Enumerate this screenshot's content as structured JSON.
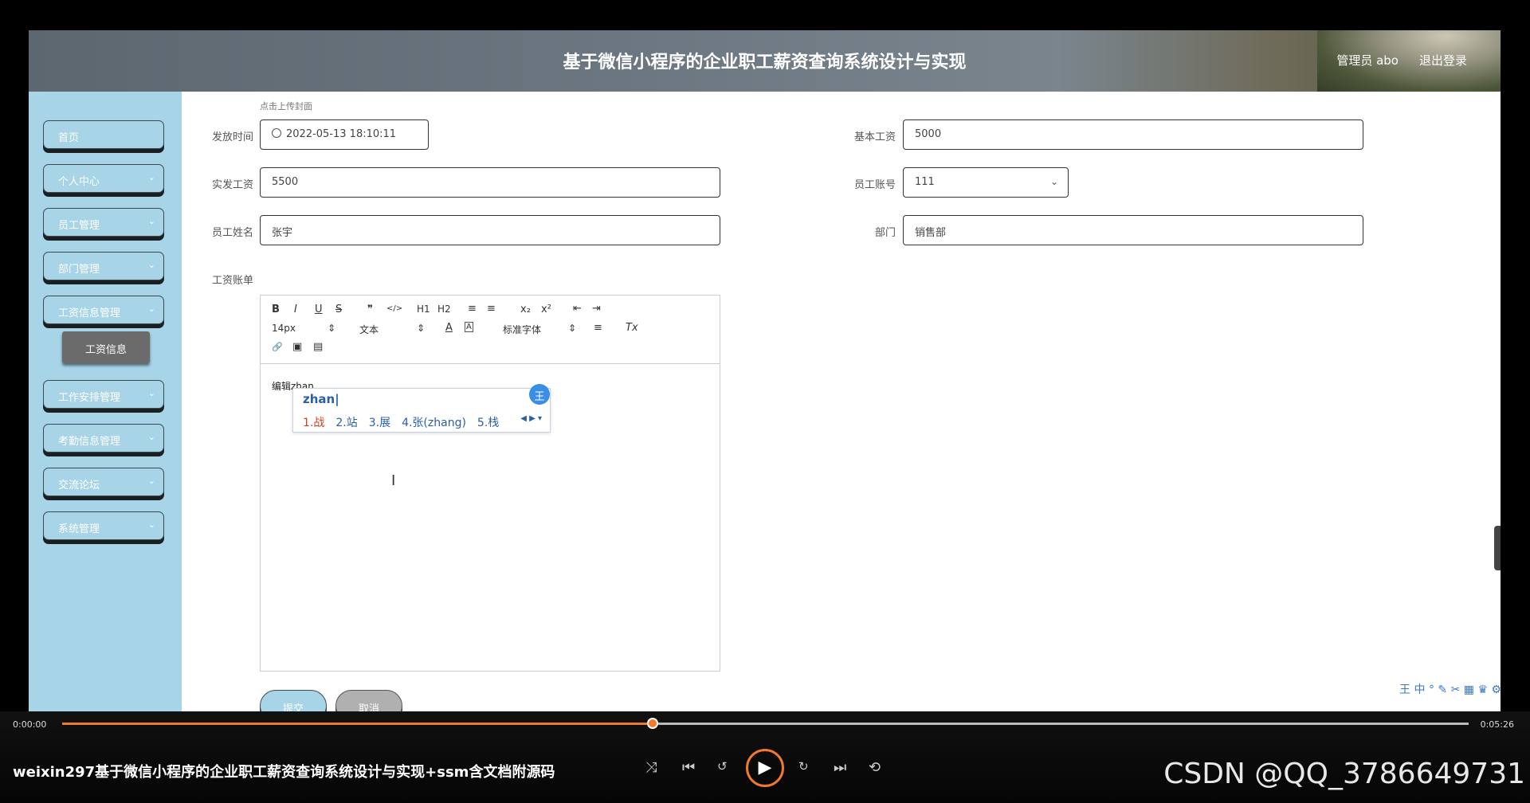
{
  "header": {
    "title": "基于微信小程序的企业职工薪资查询系统设计与实现",
    "admin": "管理员 abo",
    "logout": "退出登录"
  },
  "sidebar": {
    "items": [
      {
        "label": "首页"
      },
      {
        "label": "个人中心"
      },
      {
        "label": "员工管理"
      },
      {
        "label": "部门管理"
      },
      {
        "label": "工资信息管理"
      },
      {
        "label": "工作安排管理"
      },
      {
        "label": "考勤信息管理"
      },
      {
        "label": "交流论坛"
      },
      {
        "label": "系统管理"
      }
    ],
    "sub_item": "工资信息",
    "chevron": "chevron-down-icon"
  },
  "form": {
    "cover_hint": "点击上传封面",
    "pay_time": {
      "label": "发放时间",
      "value": "2022-05-13 18:10:11"
    },
    "base_salary": {
      "label": "基本工资",
      "value": "5000"
    },
    "actual_salary": {
      "label": "实发工资",
      "value": "5500"
    },
    "employee_account": {
      "label": "员工账号",
      "value": "111"
    },
    "employee_name": {
      "label": "员工姓名",
      "value": "张宇"
    },
    "department": {
      "label": "部门",
      "value": "销售部"
    },
    "bill": {
      "label": "工资账单"
    }
  },
  "editor": {
    "font_size": "14px",
    "text_type": "文本",
    "font_family": "标准字体",
    "content": "编辑zhan",
    "tools_row1": [
      "B",
      "I",
      "U",
      "S",
      "❞",
      "</>",
      "H1",
      "H2",
      "≡",
      "≡",
      "x₂",
      "x²",
      "⇤",
      "⇥"
    ],
    "tools_row2_extra": [
      "A",
      "A",
      "≡",
      "Tx"
    ],
    "tools_row3": [
      "🔗",
      "▣",
      "▤"
    ]
  },
  "ime": {
    "input": "zhan|",
    "badge": "王",
    "candidates": [
      "1.战",
      "2.站",
      "3.展",
      "4.张(zhang)",
      "5.栈"
    ]
  },
  "buttons": {
    "submit": "提交",
    "cancel": "取消"
  },
  "player": {
    "current_time": "0:00:00",
    "total_time": "0:05:26",
    "progress": 0.42,
    "title": "weixin297基于微信小程序的企业职工薪资查询系统设计与实现+ssm含文档附源码",
    "watermark": "CSDN @QQ_3786649731",
    "accent": "#f07a2a"
  }
}
